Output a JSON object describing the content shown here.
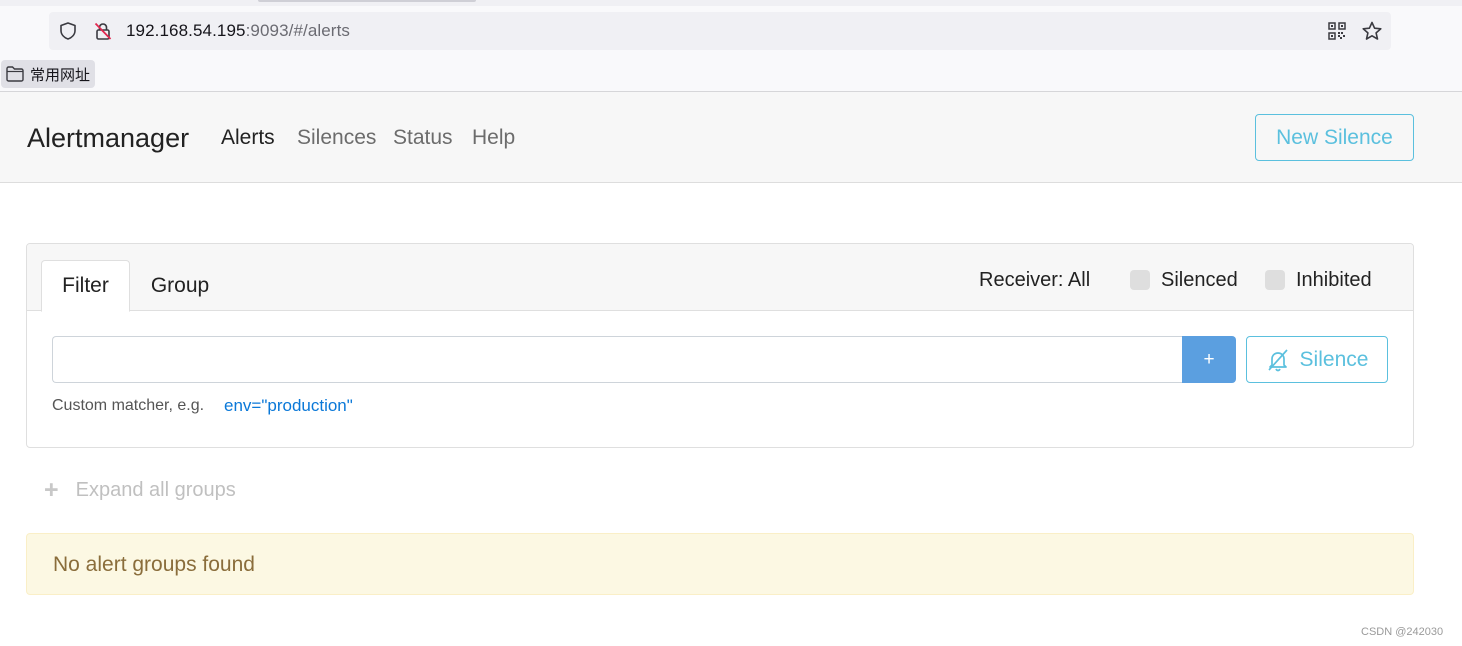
{
  "browser": {
    "url_host": "192.168.54.195",
    "url_rest": ":9093/#/alerts",
    "bookmark_label": "常用网址",
    "icons": [
      "shield-icon",
      "insecure-lock-icon",
      "qr-code-icon",
      "star-icon",
      "folder-icon"
    ]
  },
  "navbar": {
    "brand": "Alertmanager",
    "links": [
      {
        "label": "Alerts",
        "active": true
      },
      {
        "label": "Silences",
        "active": false
      },
      {
        "label": "Status",
        "active": false
      },
      {
        "label": "Help",
        "active": false
      }
    ],
    "new_silence_label": "New Silence"
  },
  "filter_card": {
    "tabs": [
      {
        "label": "Filter",
        "active": true
      },
      {
        "label": "Group",
        "active": false
      }
    ],
    "receiver_label": "Receiver: All",
    "checkboxes": [
      {
        "label": "Silenced",
        "checked": false
      },
      {
        "label": "Inhibited",
        "checked": false
      }
    ],
    "input_value": "",
    "add_button_label": "+",
    "silence_button_label": "Silence",
    "hint_text": "Custom matcher, e.g.",
    "hint_example": "env=\"production\""
  },
  "expand": {
    "icon": "+",
    "label": "Expand all groups"
  },
  "alert": {
    "message": "No alert groups found"
  },
  "watermark": "CSDN @242030",
  "colors": {
    "accent_info": "#5bc0de",
    "primary": "#5b9fe0",
    "warning_bg": "#fcf8e3",
    "warning_text": "#8a6d3b"
  }
}
